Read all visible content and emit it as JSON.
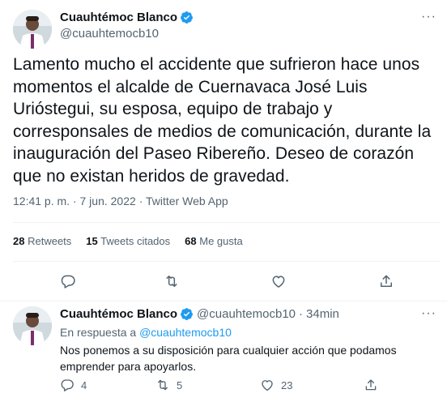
{
  "main_tweet": {
    "author": {
      "display_name": "Cuauhtémoc Blanco",
      "handle": "@cuauhtemocb10",
      "verified": true
    },
    "more_label": "···",
    "text_lines": [
      "Lamento mucho el accidente que sufrieron hace unos",
      "momentos el alcalde de Cuernavaca José Luis",
      "Urióstegui, su esposa, equipo de trabajo y",
      "corresponsales de medios de comunicación, durante la",
      "inauguración del Paseo Ribereño. Deseo de corazón",
      "que no existan heridos de gravedad."
    ],
    "time": "12:41 p. m.",
    "separator": "·",
    "date": "7 jun. 2022",
    "source": "Twitter Web App",
    "stats": {
      "retweets_count": "28",
      "retweets_label": "Retweets",
      "quotes_count": "15",
      "quotes_label": "Tweets citados",
      "likes_count": "68",
      "likes_label": "Me gusta"
    }
  },
  "reply_tweet": {
    "author": {
      "display_name": "Cuauhtémoc Blanco",
      "handle": "@cuauhtemocb10",
      "verified": true
    },
    "separator": "·",
    "time_ago": "34min",
    "more_label": "···",
    "reply_prefix": "En respuesta a",
    "reply_to_handle": "@cuauhtemocb10",
    "text_lines": [
      "Nos ponemos a su disposición para cualquier acción que podamos",
      "emprender para apoyarlos."
    ],
    "counts": {
      "replies": "4",
      "retweets": "5",
      "likes": "23"
    }
  },
  "colors": {
    "accent": "#1d9bf0",
    "text_primary": "#0f1419",
    "text_secondary": "#536471",
    "divider": "#eff3f4"
  },
  "icons": [
    "verified-badge-icon",
    "more-icon",
    "reply-icon",
    "retweet-icon",
    "like-icon",
    "share-icon"
  ]
}
